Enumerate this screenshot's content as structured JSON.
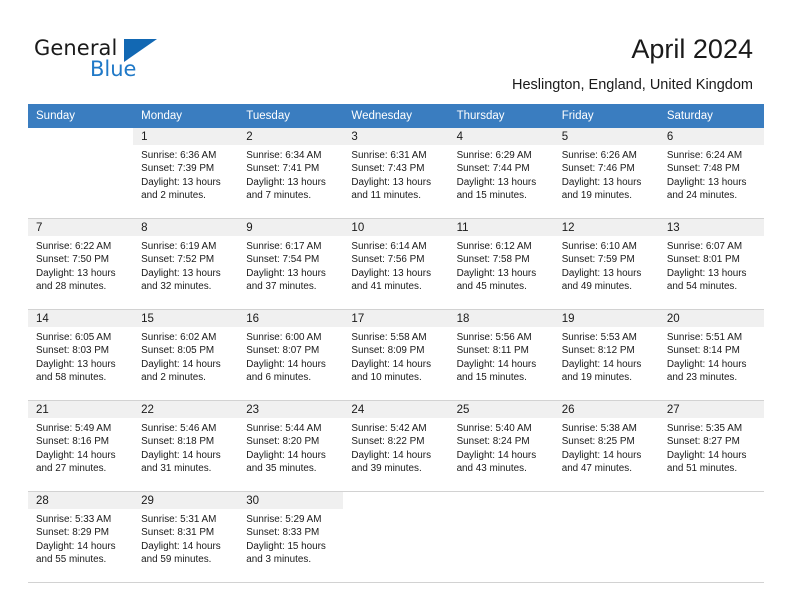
{
  "brand": {
    "name_top": "General",
    "name_bottom": "Blue",
    "triangle_color": "#1268b3",
    "blue_color": "#2079c7"
  },
  "header": {
    "title": "April 2024",
    "subtitle": "Heslington, England, United Kingdom"
  },
  "calendar": {
    "header_bg": "#3a7dc0",
    "daynum_bg": "#f0f0f0",
    "weekdays": [
      "Sunday",
      "Monday",
      "Tuesday",
      "Wednesday",
      "Thursday",
      "Friday",
      "Saturday"
    ],
    "weeks": [
      [
        {
          "day": "",
          "lines": []
        },
        {
          "day": "1",
          "lines": [
            "Sunrise: 6:36 AM",
            "Sunset: 7:39 PM",
            "Daylight: 13 hours",
            "and 2 minutes."
          ]
        },
        {
          "day": "2",
          "lines": [
            "Sunrise: 6:34 AM",
            "Sunset: 7:41 PM",
            "Daylight: 13 hours",
            "and 7 minutes."
          ]
        },
        {
          "day": "3",
          "lines": [
            "Sunrise: 6:31 AM",
            "Sunset: 7:43 PM",
            "Daylight: 13 hours",
            "and 11 minutes."
          ]
        },
        {
          "day": "4",
          "lines": [
            "Sunrise: 6:29 AM",
            "Sunset: 7:44 PM",
            "Daylight: 13 hours",
            "and 15 minutes."
          ]
        },
        {
          "day": "5",
          "lines": [
            "Sunrise: 6:26 AM",
            "Sunset: 7:46 PM",
            "Daylight: 13 hours",
            "and 19 minutes."
          ]
        },
        {
          "day": "6",
          "lines": [
            "Sunrise: 6:24 AM",
            "Sunset: 7:48 PM",
            "Daylight: 13 hours",
            "and 24 minutes."
          ]
        }
      ],
      [
        {
          "day": "7",
          "lines": [
            "Sunrise: 6:22 AM",
            "Sunset: 7:50 PM",
            "Daylight: 13 hours",
            "and 28 minutes."
          ]
        },
        {
          "day": "8",
          "lines": [
            "Sunrise: 6:19 AM",
            "Sunset: 7:52 PM",
            "Daylight: 13 hours",
            "and 32 minutes."
          ]
        },
        {
          "day": "9",
          "lines": [
            "Sunrise: 6:17 AM",
            "Sunset: 7:54 PM",
            "Daylight: 13 hours",
            "and 37 minutes."
          ]
        },
        {
          "day": "10",
          "lines": [
            "Sunrise: 6:14 AM",
            "Sunset: 7:56 PM",
            "Daylight: 13 hours",
            "and 41 minutes."
          ]
        },
        {
          "day": "11",
          "lines": [
            "Sunrise: 6:12 AM",
            "Sunset: 7:58 PM",
            "Daylight: 13 hours",
            "and 45 minutes."
          ]
        },
        {
          "day": "12",
          "lines": [
            "Sunrise: 6:10 AM",
            "Sunset: 7:59 PM",
            "Daylight: 13 hours",
            "and 49 minutes."
          ]
        },
        {
          "day": "13",
          "lines": [
            "Sunrise: 6:07 AM",
            "Sunset: 8:01 PM",
            "Daylight: 13 hours",
            "and 54 minutes."
          ]
        }
      ],
      [
        {
          "day": "14",
          "lines": [
            "Sunrise: 6:05 AM",
            "Sunset: 8:03 PM",
            "Daylight: 13 hours",
            "and 58 minutes."
          ]
        },
        {
          "day": "15",
          "lines": [
            "Sunrise: 6:02 AM",
            "Sunset: 8:05 PM",
            "Daylight: 14 hours",
            "and 2 minutes."
          ]
        },
        {
          "day": "16",
          "lines": [
            "Sunrise: 6:00 AM",
            "Sunset: 8:07 PM",
            "Daylight: 14 hours",
            "and 6 minutes."
          ]
        },
        {
          "day": "17",
          "lines": [
            "Sunrise: 5:58 AM",
            "Sunset: 8:09 PM",
            "Daylight: 14 hours",
            "and 10 minutes."
          ]
        },
        {
          "day": "18",
          "lines": [
            "Sunrise: 5:56 AM",
            "Sunset: 8:11 PM",
            "Daylight: 14 hours",
            "and 15 minutes."
          ]
        },
        {
          "day": "19",
          "lines": [
            "Sunrise: 5:53 AM",
            "Sunset: 8:12 PM",
            "Daylight: 14 hours",
            "and 19 minutes."
          ]
        },
        {
          "day": "20",
          "lines": [
            "Sunrise: 5:51 AM",
            "Sunset: 8:14 PM",
            "Daylight: 14 hours",
            "and 23 minutes."
          ]
        }
      ],
      [
        {
          "day": "21",
          "lines": [
            "Sunrise: 5:49 AM",
            "Sunset: 8:16 PM",
            "Daylight: 14 hours",
            "and 27 minutes."
          ]
        },
        {
          "day": "22",
          "lines": [
            "Sunrise: 5:46 AM",
            "Sunset: 8:18 PM",
            "Daylight: 14 hours",
            "and 31 minutes."
          ]
        },
        {
          "day": "23",
          "lines": [
            "Sunrise: 5:44 AM",
            "Sunset: 8:20 PM",
            "Daylight: 14 hours",
            "and 35 minutes."
          ]
        },
        {
          "day": "24",
          "lines": [
            "Sunrise: 5:42 AM",
            "Sunset: 8:22 PM",
            "Daylight: 14 hours",
            "and 39 minutes."
          ]
        },
        {
          "day": "25",
          "lines": [
            "Sunrise: 5:40 AM",
            "Sunset: 8:24 PM",
            "Daylight: 14 hours",
            "and 43 minutes."
          ]
        },
        {
          "day": "26",
          "lines": [
            "Sunrise: 5:38 AM",
            "Sunset: 8:25 PM",
            "Daylight: 14 hours",
            "and 47 minutes."
          ]
        },
        {
          "day": "27",
          "lines": [
            "Sunrise: 5:35 AM",
            "Sunset: 8:27 PM",
            "Daylight: 14 hours",
            "and 51 minutes."
          ]
        }
      ],
      [
        {
          "day": "28",
          "lines": [
            "Sunrise: 5:33 AM",
            "Sunset: 8:29 PM",
            "Daylight: 14 hours",
            "and 55 minutes."
          ]
        },
        {
          "day": "29",
          "lines": [
            "Sunrise: 5:31 AM",
            "Sunset: 8:31 PM",
            "Daylight: 14 hours",
            "and 59 minutes."
          ]
        },
        {
          "day": "30",
          "lines": [
            "Sunrise: 5:29 AM",
            "Sunset: 8:33 PM",
            "Daylight: 15 hours",
            "and 3 minutes."
          ]
        },
        {
          "day": "",
          "lines": []
        },
        {
          "day": "",
          "lines": []
        },
        {
          "day": "",
          "lines": []
        },
        {
          "day": "",
          "lines": []
        }
      ]
    ]
  }
}
